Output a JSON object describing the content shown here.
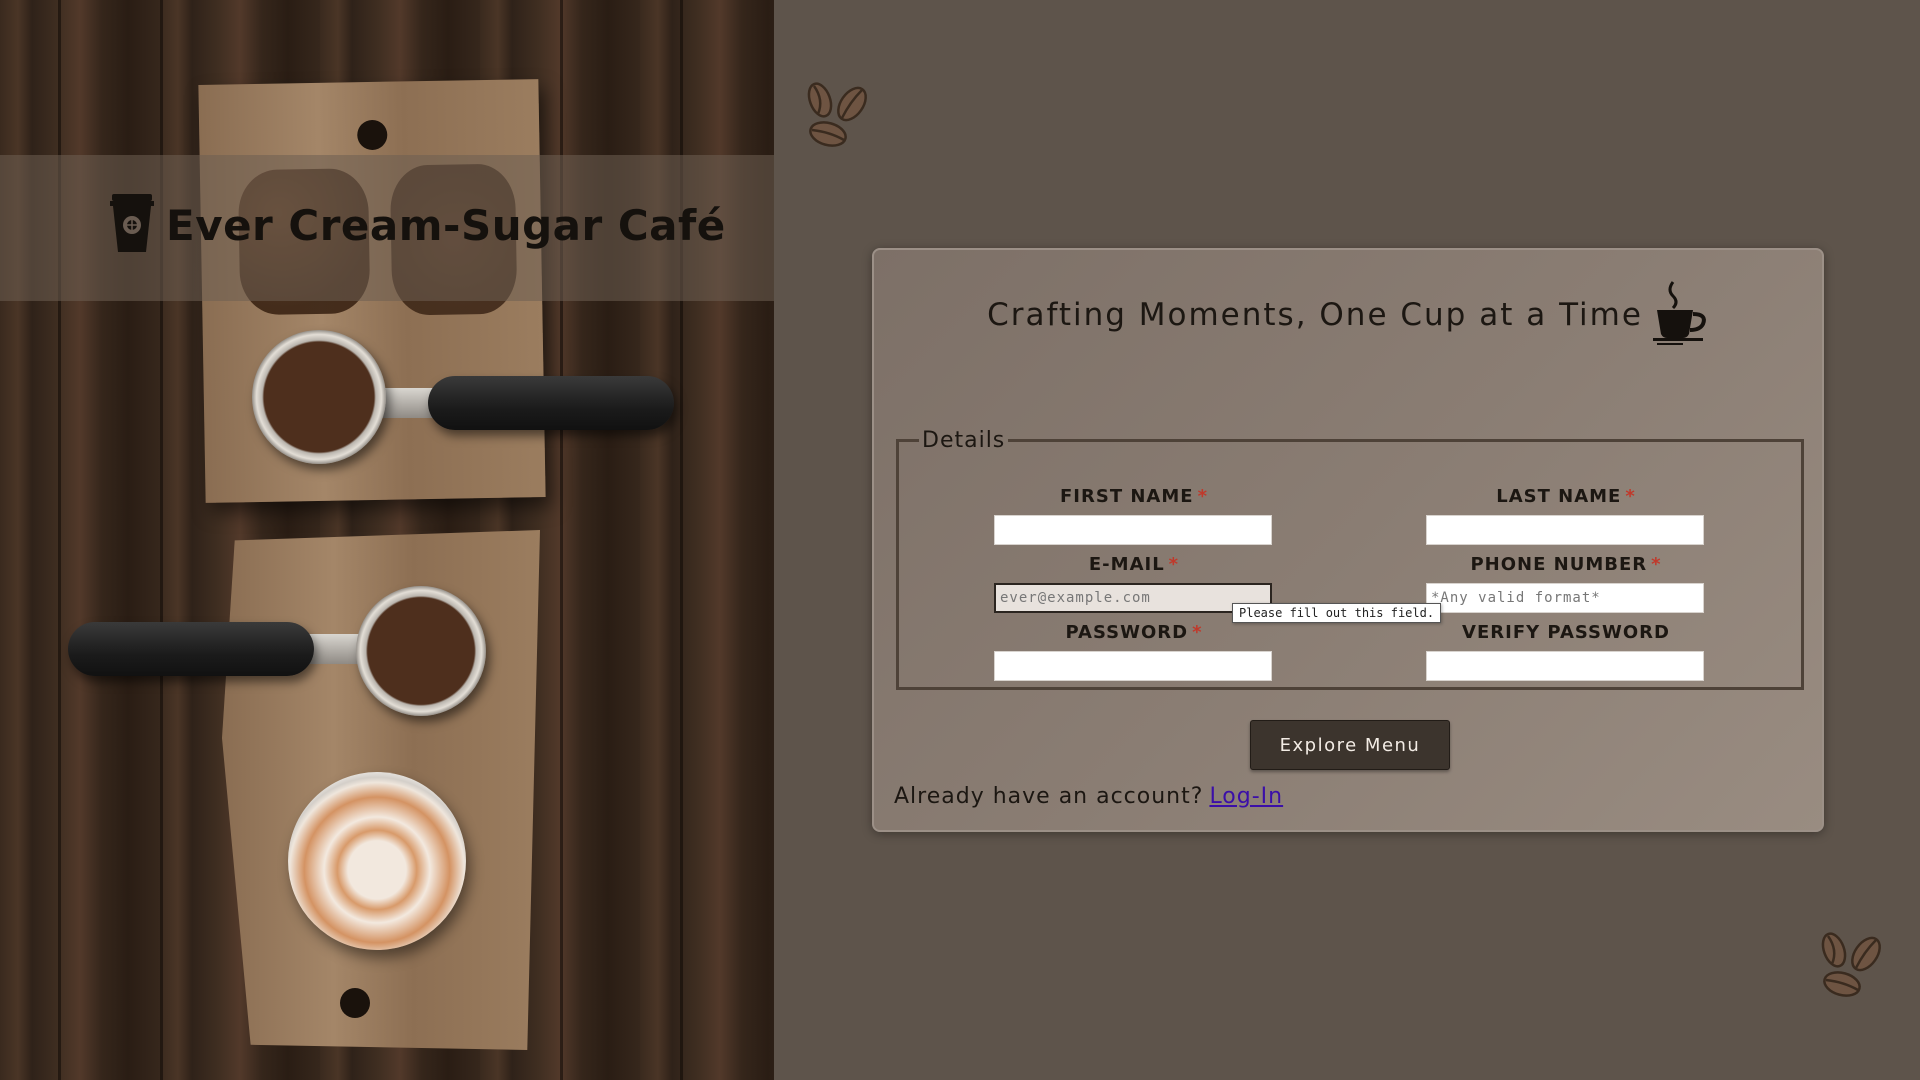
{
  "brand": {
    "title": "Ever Cream-Sugar Café"
  },
  "card": {
    "tagline": "Crafting Moments, One Cup at a Time",
    "legend": "Details",
    "fields": {
      "first_name": {
        "label": "FIRST NAME",
        "required": "*",
        "value": "",
        "placeholder": ""
      },
      "last_name": {
        "label": "LAST NAME",
        "required": "*",
        "value": "",
        "placeholder": ""
      },
      "email": {
        "label": "E-MAIL",
        "required": "*",
        "value": "",
        "placeholder": "ever@example.com"
      },
      "phone": {
        "label": "PHONE NUMBER",
        "required": "*",
        "value": "",
        "placeholder": "*Any valid format*"
      },
      "password": {
        "label": "PASSWORD",
        "required": "*",
        "value": ""
      },
      "verify_password": {
        "label": "VERIFY PASSWORD",
        "value": ""
      }
    },
    "validation_tooltip": "Please fill out this field.",
    "submit_label": "Explore Menu",
    "account_prompt": "Already have an account?",
    "login_link": "Log-In"
  },
  "icons": {
    "brand": "coffee-cup-icon",
    "tagline": "coffee-mug-icon",
    "decor": "coffee-beans-icon"
  },
  "colors": {
    "background": "#5e544b",
    "card": "#8a7d73",
    "button": "#3c342d",
    "required": "#c0392b",
    "link": "#3b0fa8"
  }
}
